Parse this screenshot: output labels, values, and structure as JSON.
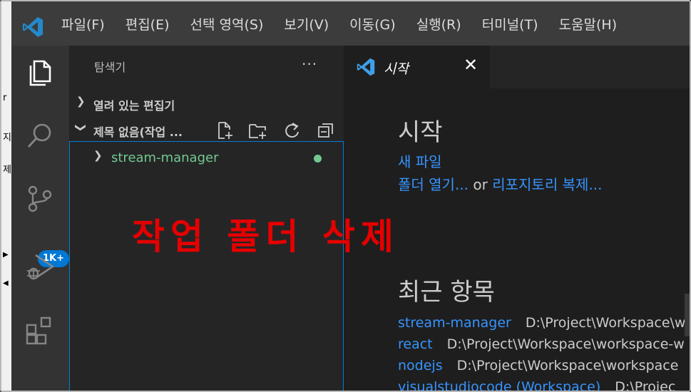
{
  "menu": {
    "items": [
      "파일(F)",
      "편집(E)",
      "선택 영역(S)",
      "보기(V)",
      "이동(G)",
      "실행(R)",
      "터미널(T)",
      "도움말(H)"
    ]
  },
  "activity_bar": {
    "icons": [
      "explorer-icon",
      "search-icon",
      "source-control-icon",
      "run-debug-icon",
      "extensions-icon"
    ],
    "source_control_badge": "1K+"
  },
  "sidebar": {
    "title": "탐색기",
    "more": "···",
    "open_editors_label": "열려 있는 편집기",
    "workspace_label": "제목 없음(작업 ...",
    "tree": [
      {
        "name": "stream-manager"
      }
    ]
  },
  "tabs": [
    {
      "label": "시작",
      "close": "✕"
    }
  ],
  "welcome": {
    "title": "시작",
    "new_file": "새 파일",
    "open_folder": "폴더 열기...",
    "or": "or",
    "clone_repo": "리포지토리 복제...",
    "recent_title": "최근 항목",
    "recent": [
      {
        "name": "stream-manager",
        "path": "D:\\Project\\Workspace\\w"
      },
      {
        "name": "react",
        "path": "D:\\Project\\Workspace\\workspace-w"
      },
      {
        "name": "nodejs",
        "path": "D:\\Project\\Workspace\\workspace"
      },
      {
        "name": "visualstudiocode (Workspace)",
        "path": "D:\\Projec"
      }
    ]
  },
  "annotation": "작업 폴더 삭제",
  "background_fringe": [
    "r",
    "지",
    "제",
    "▶",
    "◀"
  ],
  "colors": {
    "accent": "#0078d4",
    "link": "#3794ff",
    "git_modified": "#73c991",
    "annotation": "#e50000"
  }
}
